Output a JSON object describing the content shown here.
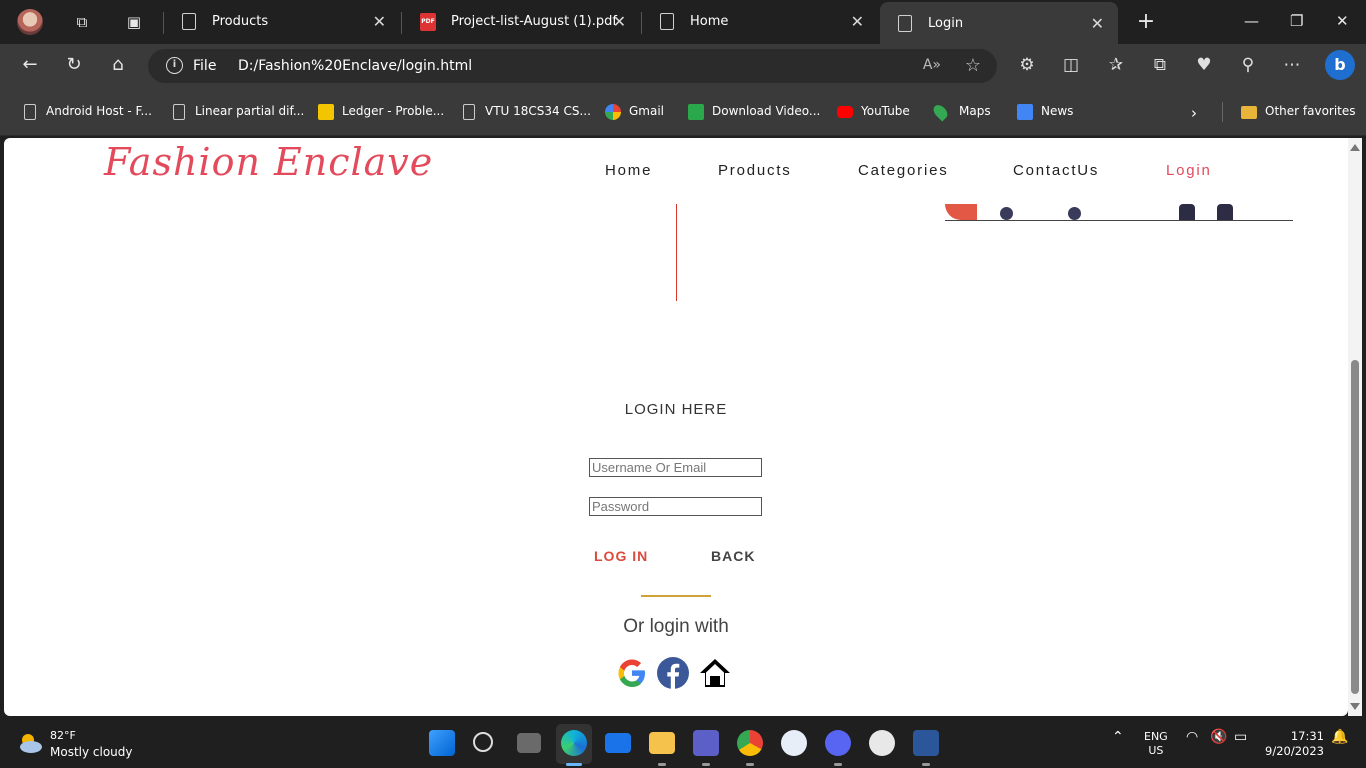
{
  "browser": {
    "tabs": [
      {
        "title": "Products",
        "active": false
      },
      {
        "title": "Project-list-August (1).pdf",
        "active": false
      },
      {
        "title": "Home",
        "active": false
      },
      {
        "title": "Login",
        "active": true
      }
    ],
    "address": {
      "scheme": "File",
      "url": "D:/Fashion%20Enclave/login.html"
    },
    "bookmarks": [
      "Android Host - F...",
      "Linear partial dif...",
      "Ledger - Proble...",
      "VTU 18CS34 CS...",
      "Gmail",
      "Download Video...",
      "YouTube",
      "Maps",
      "News"
    ],
    "other_favorites": "Other favorites"
  },
  "site": {
    "logo": "Fashion Enclave",
    "nav": [
      "Home",
      "Products",
      "Categories",
      "ContactUs",
      "Login"
    ],
    "accent": "#e34a5c"
  },
  "login": {
    "title": "LOGIN HERE",
    "username_placeholder": "Username Or Email",
    "password_placeholder": "Password",
    "login_label": "LOG IN",
    "back_label": "BACK",
    "or_text": "Or login with",
    "social": [
      "google-icon",
      "facebook-icon",
      "home-icon"
    ]
  },
  "taskbar": {
    "weather_temp": "82°F",
    "weather_desc": "Mostly cloudy",
    "lang": "ENG",
    "region": "US",
    "time": "17:31",
    "date": "9/20/2023"
  }
}
